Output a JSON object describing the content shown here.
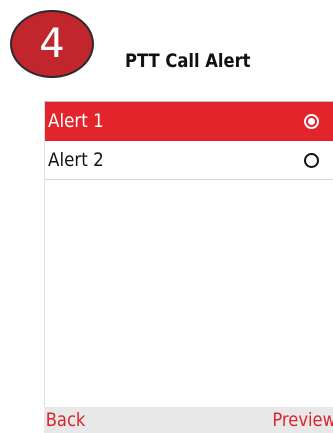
{
  "step": {
    "number": "4",
    "color": "#c0262c"
  },
  "header": {
    "title": "PTT Call Alert"
  },
  "list": {
    "items": [
      {
        "label": "Alert 1",
        "selected": true
      },
      {
        "label": "Alert 2",
        "selected": false
      }
    ]
  },
  "softkeys": {
    "left": "Back",
    "right": "Preview"
  },
  "colors": {
    "accent": "#e2252b",
    "softkey_text": "#d9262c",
    "softkey_bar": "#e8e8e8"
  }
}
